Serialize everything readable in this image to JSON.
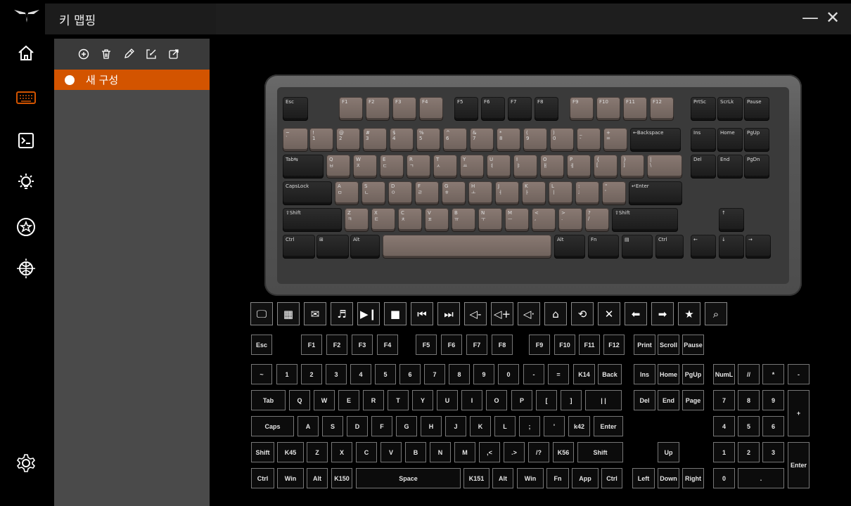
{
  "app": {
    "title": "키 맵핑",
    "minimize": "—",
    "close": "✕"
  },
  "nav": {
    "items": [
      "home-icon",
      "keyboard-icon",
      "macro-icon",
      "lighting-icon",
      "badge-icon",
      "globe-icon"
    ],
    "settings": "settings-icon"
  },
  "profiles": {
    "items": [
      {
        "name": "새 구성",
        "active": true
      }
    ]
  },
  "colors": {
    "accent": "#d35400",
    "panel": "#4a4a4a",
    "keycap_light": "#7d6e67",
    "keycap_dark": "#222222"
  },
  "keyboard_preview": {
    "row0": [
      [
        "Esc",
        "d"
      ],
      [
        "F1",
        "l"
      ],
      [
        "F2",
        "l"
      ],
      [
        "F3",
        "l"
      ],
      [
        "F4",
        "l"
      ],
      [
        "F5",
        "d"
      ],
      [
        "F6",
        "d"
      ],
      [
        "F7",
        "d"
      ],
      [
        "F8",
        "d"
      ],
      [
        "F9",
        "l"
      ],
      [
        "F10",
        "l"
      ],
      [
        "F11",
        "l"
      ],
      [
        "F12",
        "l"
      ],
      [
        "PrtSc",
        "d"
      ],
      [
        "ScrLk",
        "d"
      ],
      [
        "Pause",
        "d"
      ]
    ],
    "row1": [
      [
        "~\n`",
        "l"
      ],
      [
        "!\n1",
        "l"
      ],
      [
        "@\n2",
        "l"
      ],
      [
        "#\n3",
        "l"
      ],
      [
        "$\n4",
        "l"
      ],
      [
        "%\n5",
        "l"
      ],
      [
        "^\n6",
        "l"
      ],
      [
        "&\n7",
        "l"
      ],
      [
        "*\n8",
        "l"
      ],
      [
        "(\n9",
        "l"
      ],
      [
        ")\n0",
        "l"
      ],
      [
        "_\n-",
        "l"
      ],
      [
        "+\n=",
        "l"
      ],
      [
        "←Backspace",
        "d"
      ],
      [
        "Ins",
        "d"
      ],
      [
        "Home",
        "d"
      ],
      [
        "PgUp",
        "d"
      ]
    ],
    "row2": [
      [
        "Tab⇆",
        "d"
      ],
      [
        "Q\nㅂ",
        "l"
      ],
      [
        "W\nㅈ",
        "l"
      ],
      [
        "E\nㄷ",
        "l"
      ],
      [
        "R\nㄱ",
        "l"
      ],
      [
        "T\nㅅ",
        "l"
      ],
      [
        "Y\nㅛ",
        "l"
      ],
      [
        "U\nㅕ",
        "l"
      ],
      [
        "I\nㅑ",
        "l"
      ],
      [
        "O\nㅐ",
        "l"
      ],
      [
        "P\nㅔ",
        "l"
      ],
      [
        "{\n[",
        "l"
      ],
      [
        "}\n]",
        "l"
      ],
      [
        "|\n\\",
        "l"
      ],
      [
        "Del",
        "d"
      ],
      [
        "End",
        "d"
      ],
      [
        "PgDn",
        "d"
      ]
    ],
    "row3": [
      [
        "CapsLock",
        "d"
      ],
      [
        "A\nㅁ",
        "l"
      ],
      [
        "S\nㄴ",
        "l"
      ],
      [
        "D\nㅇ",
        "l"
      ],
      [
        "F\nㄹ",
        "l"
      ],
      [
        "G\nㅎ",
        "l"
      ],
      [
        "H\nㅗ",
        "l"
      ],
      [
        "J\nㅓ",
        "l"
      ],
      [
        "K\nㅏ",
        "l"
      ],
      [
        "L\nㅣ",
        "l"
      ],
      [
        ":\n;",
        "l"
      ],
      [
        "\"\n'",
        "l"
      ],
      [
        "↵Enter",
        "d"
      ]
    ],
    "row4": [
      [
        "⇧Shift",
        "d"
      ],
      [
        "Z\nㅋ",
        "l"
      ],
      [
        "X\nㅌ",
        "l"
      ],
      [
        "C\nㅊ",
        "l"
      ],
      [
        "V\nㅍ",
        "l"
      ],
      [
        "B\nㅠ",
        "l"
      ],
      [
        "N\nㅜ",
        "l"
      ],
      [
        "M\nㅡ",
        "l"
      ],
      [
        "<\n,",
        "l"
      ],
      [
        ">\n.",
        "l"
      ],
      [
        "?\n/",
        "l"
      ],
      [
        "⇧Shift",
        "d"
      ],
      [
        "↑",
        "d"
      ]
    ],
    "row5": [
      [
        "Ctrl",
        "d"
      ],
      [
        "⊞",
        "d"
      ],
      [
        "Alt",
        "d"
      ],
      [
        "",
        "l"
      ],
      [
        "Alt",
        "d"
      ],
      [
        "Fn",
        "d"
      ],
      [
        "▤",
        "d"
      ],
      [
        "Ctrl",
        "d"
      ],
      [
        "←",
        "d"
      ],
      [
        "↓",
        "d"
      ],
      [
        "→",
        "d"
      ]
    ]
  },
  "func_keys": [
    "monitor-icon",
    "calculator-icon",
    "mail-icon",
    "music-icon",
    "play-pause-icon",
    "stop-icon",
    "prev-track-icon",
    "next-track-icon",
    "volume-down-icon",
    "volume-up-icon",
    "mute-icon",
    "home-key-icon",
    "refresh-icon",
    "close-key-icon",
    "arrow-left-icon",
    "arrow-right-icon",
    "favorite-icon",
    "search-key-icon"
  ],
  "virtual_keys": {
    "row0": [
      "Esc",
      "F1",
      "F2",
      "F3",
      "F4",
      "F5",
      "F6",
      "F7",
      "F8",
      "F9",
      "F10",
      "F11",
      "F12",
      "Print",
      "Scroll",
      "Pause"
    ],
    "row1": [
      "~",
      "1",
      "2",
      "3",
      "4",
      "5",
      "6",
      "7",
      "8",
      "9",
      "0",
      "-",
      "=",
      "K14",
      "Back",
      "Ins",
      "Home",
      "PgUp",
      "NumL",
      "//",
      "*",
      "-"
    ],
    "row2": [
      "Tab",
      "Q",
      "W",
      "E",
      "R",
      "T",
      "Y",
      "U",
      "I",
      "O",
      "P",
      "[",
      "]",
      "| |",
      "Del",
      "End",
      "Page",
      "7",
      "8",
      "9",
      "+"
    ],
    "row3": [
      "Caps",
      "A",
      "S",
      "D",
      "F",
      "G",
      "H",
      "J",
      "K",
      "L",
      ";",
      "'",
      "k42",
      "Enter",
      "4",
      "5",
      "6"
    ],
    "row4": [
      "Shift",
      "K45",
      "Z",
      "X",
      "C",
      "V",
      "B",
      "N",
      "M",
      ",<",
      ".>",
      "/?",
      "K56",
      "Shift",
      "Up",
      "1",
      "2",
      "3",
      "Enter"
    ],
    "row5": [
      "Ctrl",
      "Win",
      "Alt",
      "K150",
      "Space",
      "K151",
      "Alt",
      "Win",
      "Fn",
      "App",
      "Ctrl",
      "Left",
      "Down",
      "Right",
      "0",
      "."
    ]
  }
}
